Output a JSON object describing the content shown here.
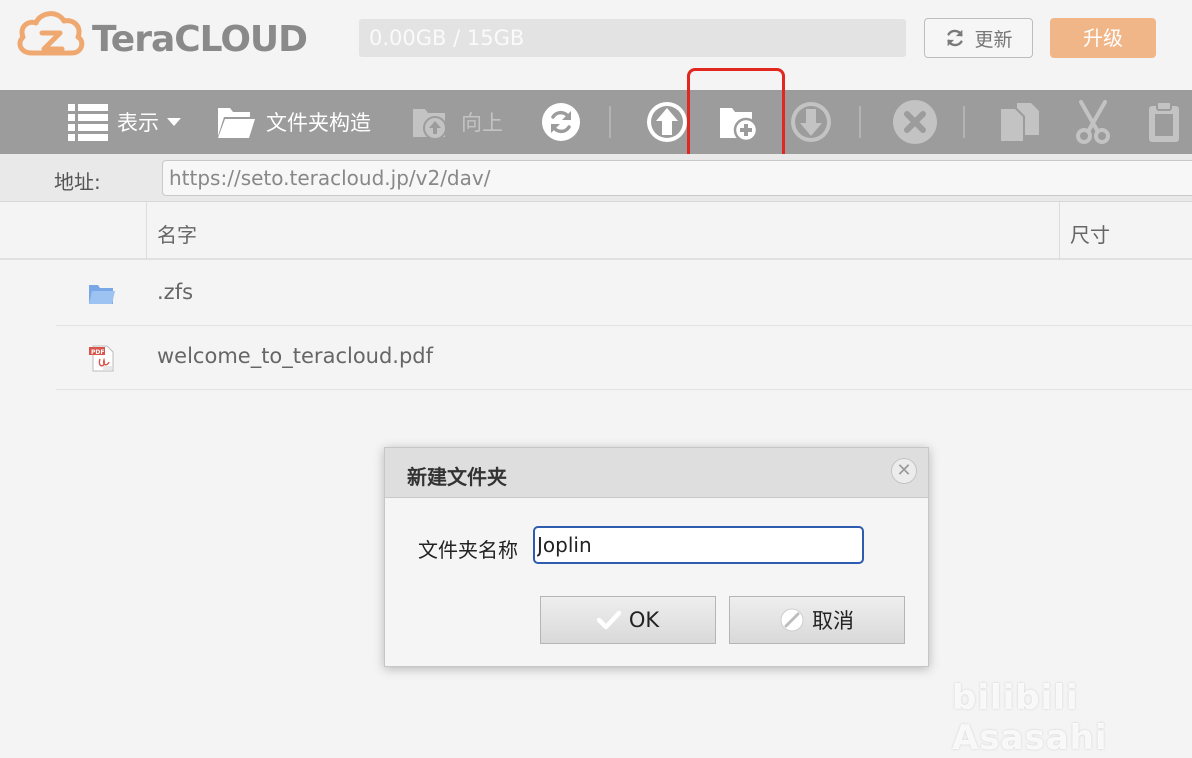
{
  "header": {
    "brand": "TeraCLOUD",
    "quota_text": "0.00GB / 15GB",
    "refresh_label": "更新",
    "upgrade_label": "升级"
  },
  "toolbar": {
    "view_label": "表示",
    "folder_structure_label": "文件夹构造",
    "up_label": "向上"
  },
  "address": {
    "label": "地址:",
    "url": "https://seto.teracloud.jp/v2/dav/"
  },
  "list": {
    "columns": [
      "名字",
      "尺寸"
    ],
    "files": [
      {
        "name": ".zfs",
        "type": "folder"
      },
      {
        "name": "welcome_to_teracloud.pdf",
        "type": "pdf"
      }
    ]
  },
  "dialog": {
    "title": "新建文件夹",
    "field_label": "文件夹名称",
    "field_value": "Joplin",
    "ok_label": "OK",
    "cancel_label": "取消",
    "close_glyph": "✕"
  },
  "watermark": "bilibili Asasahi",
  "colors": {
    "toolbar_bg": "#9c9c9c",
    "upgrade_bg": "#f1b688",
    "logo_orange": "#efa86f",
    "highlight_red": "#e0281e",
    "input_focus": "#2e5cae"
  }
}
